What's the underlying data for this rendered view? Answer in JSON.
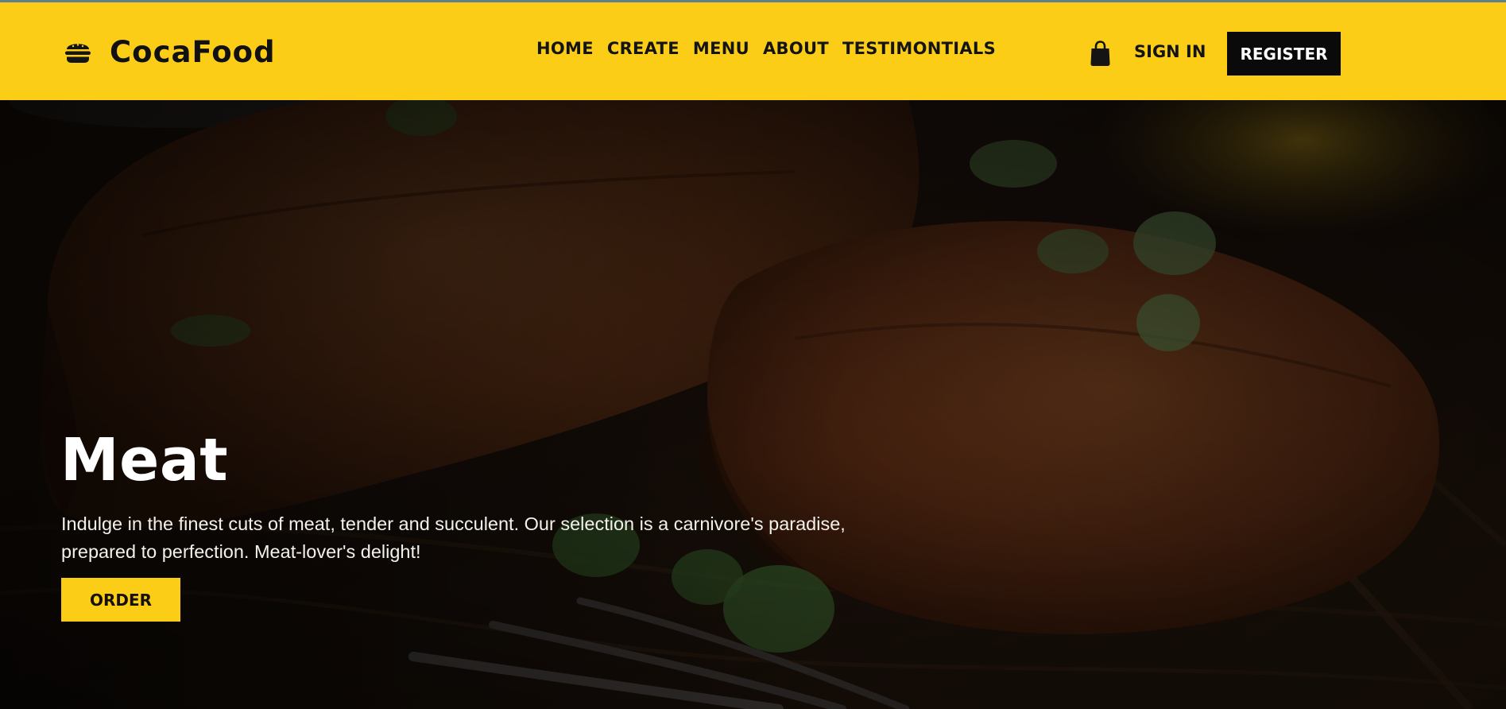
{
  "brand": {
    "icon": "burger-icon",
    "name": "CocaFood"
  },
  "nav": {
    "items": [
      {
        "label": "HOME"
      },
      {
        "label": "CREATE"
      },
      {
        "label": "MENU"
      },
      {
        "label": "ABOUT"
      },
      {
        "label": "TESTIMONTIALS"
      }
    ]
  },
  "header_actions": {
    "cart_icon": "shopping-bag-icon",
    "sign_in_label": "SIGN IN",
    "register_label": "REGISTER"
  },
  "hero": {
    "background": "steak-photo",
    "title": "Meat",
    "description": "Indulge in the finest cuts of meat, tender and succulent. Our selection is a carnivore's paradise, prepared to perfection. Meat-lover's delight!",
    "order_label": "ORDER"
  },
  "colors": {
    "accent": "#fccd16",
    "dark": "#0a0a0a",
    "text_light": "#ffffff"
  }
}
